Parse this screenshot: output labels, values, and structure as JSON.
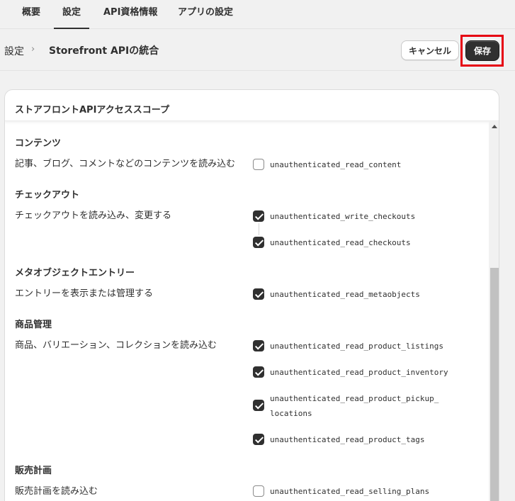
{
  "tabs": [
    {
      "label": "概要",
      "active": false
    },
    {
      "label": "設定",
      "active": true
    },
    {
      "label": "API資格情報",
      "active": false
    },
    {
      "label": "アプリの設定",
      "active": false
    }
  ],
  "breadcrumb": {
    "root": "設定",
    "separator": "›",
    "current": "Storefront APIの統合"
  },
  "actions": {
    "cancel_label": "キャンセル",
    "save_label": "保存"
  },
  "card": {
    "title": "ストアフロントAPIアクセススコープ",
    "sections": [
      {
        "title": "コンテンツ",
        "description": "記事、ブログ、コメントなどのコンテンツを読み込む",
        "scopes": [
          {
            "name": "unauthenticated_read_content",
            "checked": false
          }
        ]
      },
      {
        "title": "チェックアウト",
        "description": "チェックアウトを読み込み、変更する",
        "scopes": [
          {
            "name": "unauthenticated_write_checkouts",
            "checked": true
          },
          {
            "name": "unauthenticated_read_checkouts",
            "checked": true
          }
        ]
      },
      {
        "title": "メタオブジェクトエントリー",
        "description": "エントリーを表示または管理する",
        "scopes": [
          {
            "name": "unauthenticated_read_metaobjects",
            "checked": true
          }
        ]
      },
      {
        "title": "商品管理",
        "description": "商品、バリエーション、コレクションを読み込む",
        "scopes": [
          {
            "name": "unauthenticated_read_product_listings",
            "checked": true
          },
          {
            "name": "unauthenticated_read_product_inventory",
            "checked": true
          },
          {
            "name_line1": "unauthenticated_read_product_pickup_",
            "name_line2": "locations",
            "checked": true
          },
          {
            "name": "unauthenticated_read_product_tags",
            "checked": true
          }
        ]
      },
      {
        "title": "販売計画",
        "description": "販売計画を読み込む",
        "scopes": [
          {
            "name": "unauthenticated_read_selling_plans",
            "checked": false
          }
        ]
      }
    ]
  },
  "colors": {
    "highlight": "#e60012",
    "primary_button": "#303030",
    "checkbox_checked": "#303030"
  }
}
